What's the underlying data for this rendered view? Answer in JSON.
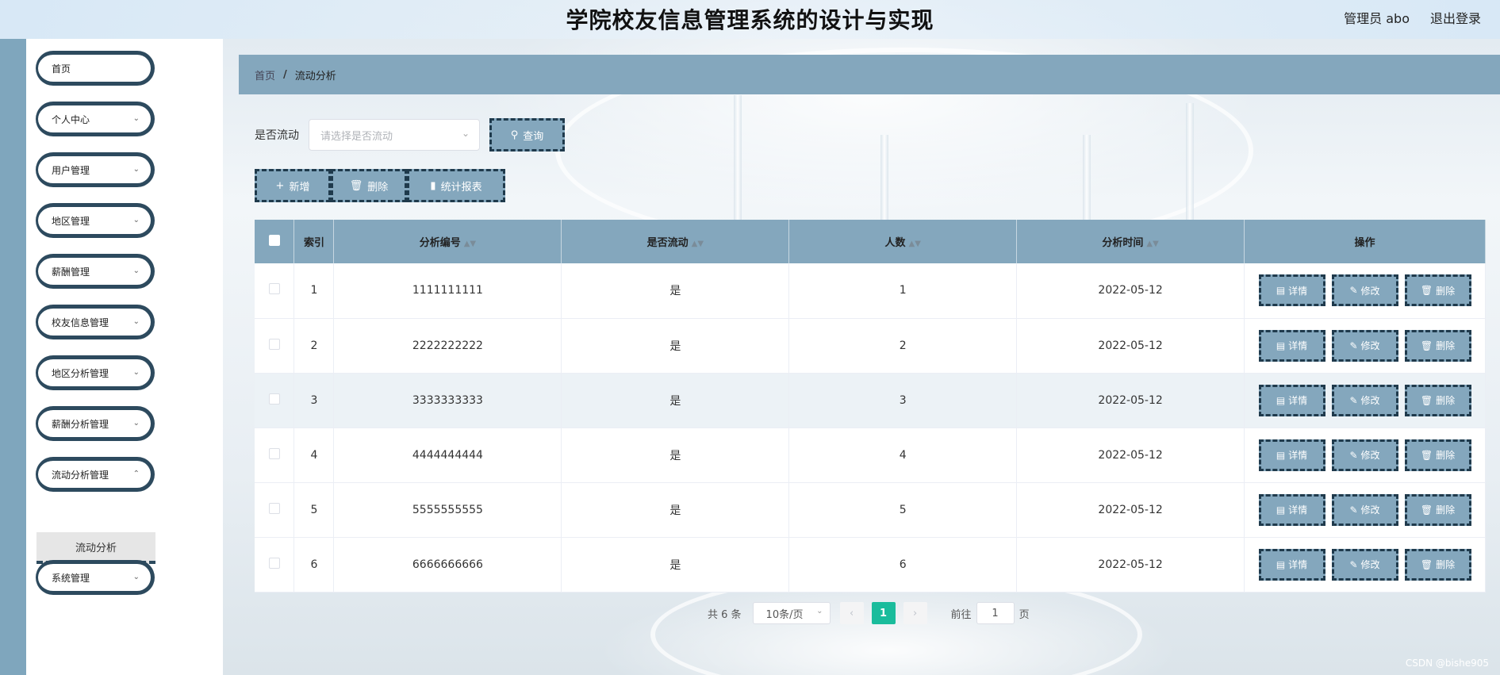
{
  "header": {
    "title": "学院校友信息管理系统的设计与实现",
    "user": "管理员 abo",
    "logout": "退出登录"
  },
  "sidebar": {
    "items": [
      {
        "label": "首页",
        "has_chevron": false
      },
      {
        "label": "个人中心",
        "has_chevron": true
      },
      {
        "label": "用户管理",
        "has_chevron": true
      },
      {
        "label": "地区管理",
        "has_chevron": true
      },
      {
        "label": "薪酬管理",
        "has_chevron": true
      },
      {
        "label": "校友信息管理",
        "has_chevron": true
      },
      {
        "label": "地区分析管理",
        "has_chevron": true
      },
      {
        "label": "薪酬分析管理",
        "has_chevron": true
      },
      {
        "label": "流动分析管理",
        "has_chevron": true
      },
      {
        "label": "系统管理",
        "has_chevron": true
      }
    ],
    "active_sub": "流动分析"
  },
  "breadcrumb": {
    "home": "首页",
    "separator": "/",
    "current": "流动分析"
  },
  "search": {
    "label": "是否流动",
    "placeholder": "请选择是否流动",
    "query_button": "查询"
  },
  "actions": {
    "add": "新增",
    "delete": "删除",
    "report": "统计报表"
  },
  "table": {
    "columns": [
      "索引",
      "分析编号",
      "是否流动",
      "人数",
      "分析时间",
      "操作"
    ],
    "rows": [
      {
        "index": "1",
        "code": "1111111111",
        "flow": "是",
        "count": "1",
        "time": "2022-05-12"
      },
      {
        "index": "2",
        "code": "2222222222",
        "flow": "是",
        "count": "2",
        "time": "2022-05-12"
      },
      {
        "index": "3",
        "code": "3333333333",
        "flow": "是",
        "count": "3",
        "time": "2022-05-12"
      },
      {
        "index": "4",
        "code": "4444444444",
        "flow": "是",
        "count": "4",
        "time": "2022-05-12"
      },
      {
        "index": "5",
        "code": "5555555555",
        "flow": "是",
        "count": "5",
        "time": "2022-05-12"
      },
      {
        "index": "6",
        "code": "6666666666",
        "flow": "是",
        "count": "6",
        "time": "2022-05-12"
      }
    ],
    "row_actions": {
      "detail": "详情",
      "edit": "修改",
      "delete": "删除"
    }
  },
  "pagination": {
    "total": "共 6 条",
    "page_size": "10条/页",
    "current_page": "1",
    "goto_label": "前往",
    "goto_value": "1",
    "page_unit": "页"
  },
  "watermark": "CSDN @bishe905",
  "colors": {
    "accent": "#84a7bd",
    "border_dark": "#1f3a4c",
    "page_active": "#1abc9c"
  }
}
